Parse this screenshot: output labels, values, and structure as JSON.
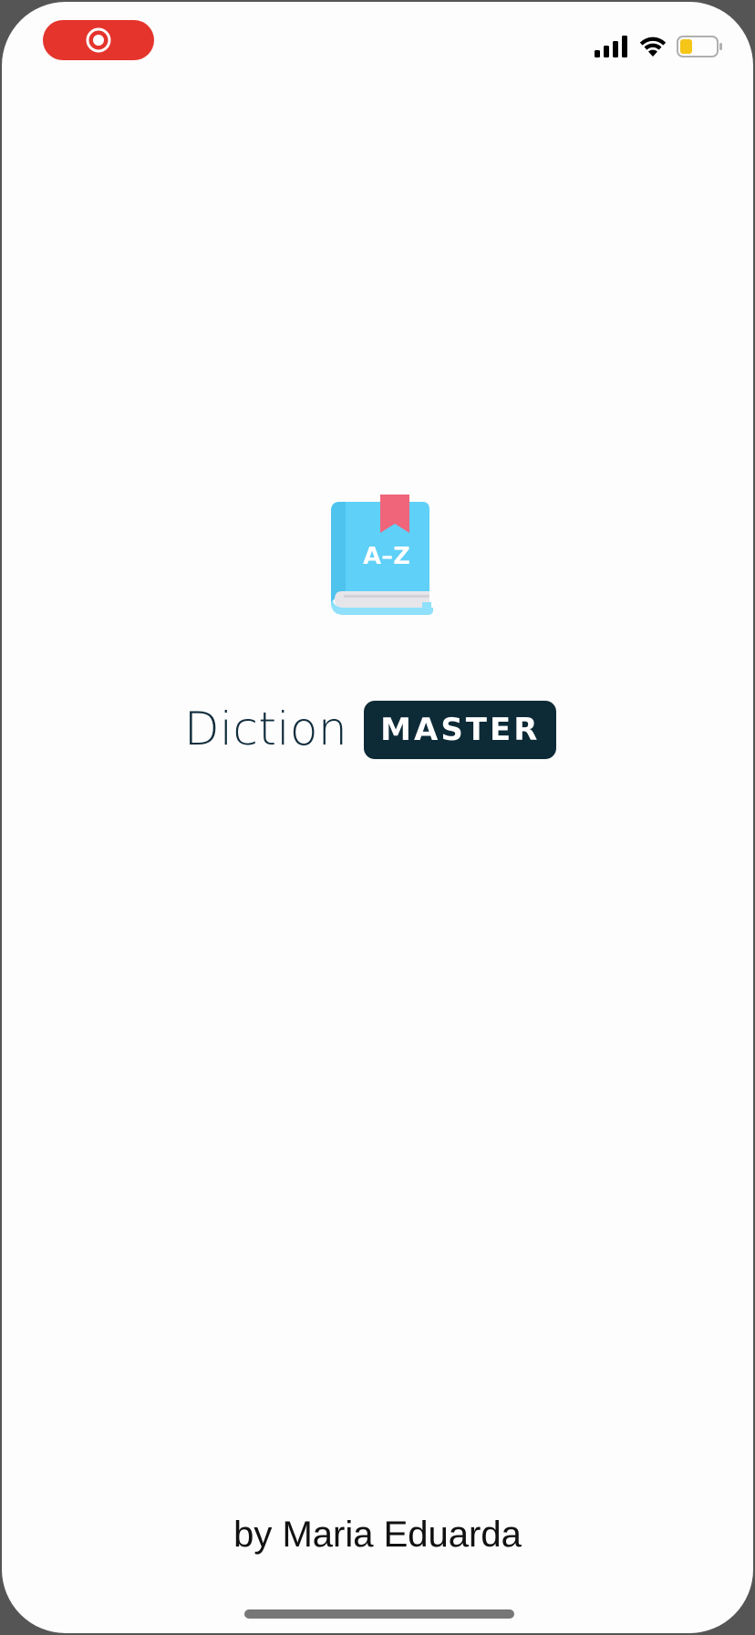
{
  "status_bar": {
    "recording_icon": "screen-record-icon",
    "signal_icon": "cellular-signal-icon",
    "wifi_icon": "wifi-icon",
    "battery_icon": "battery-low-icon",
    "record_color": "#e5342c",
    "battery_color": "#f5c518"
  },
  "splash": {
    "logo_icon": "dictionary-book-az-icon",
    "logo_text": "A–Z",
    "brand_word": "Diction",
    "brand_badge": "MASTER",
    "author": "by Maria Eduarda",
    "brand_color": "#0d2a37"
  }
}
